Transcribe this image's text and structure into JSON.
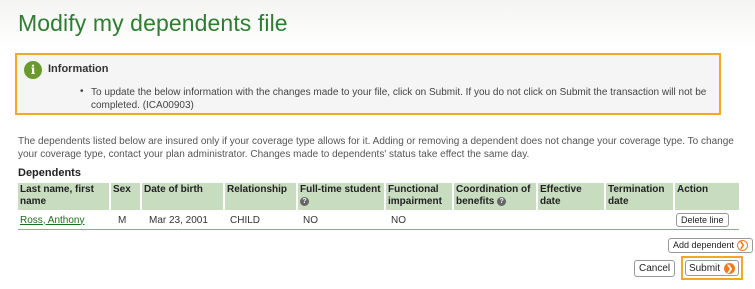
{
  "page": {
    "title": "Modify my dependents file"
  },
  "info": {
    "heading": "Information",
    "icon": "info-icon",
    "bullet": "•",
    "text": "To update the below information with the changes made to your file, click on Submit. If you do not click on Submit the transaction will not be completed. (ICA00903)"
  },
  "intro": "The dependents listed below are insured only if your coverage type allows for it. Adding or removing a dependent does not change your coverage type. To change your coverage type, contact your plan administrator. Changes made to dependents' status take effect the same day.",
  "dependents": {
    "title": "Dependents",
    "columns": {
      "name": "Last name, first name",
      "sex": "Sex",
      "dob": "Date of birth",
      "relationship": "Relationship",
      "fulltime": "Full-time student",
      "functional": "Functional impairment",
      "coordination": "Coordination of benefits",
      "effective": "Effective date",
      "termination": "Termination date",
      "action": "Action"
    },
    "help_glyph": "?",
    "rows": [
      {
        "name": "Ross, Anthony",
        "sex": "M",
        "dob": "Mar 23, 2001",
        "relationship": "CHILD",
        "fulltime": "NO",
        "functional": "NO",
        "coordination": "",
        "effective": "",
        "termination": "",
        "action": "Delete line"
      }
    ]
  },
  "buttons": {
    "add_dependent": "Add dependent",
    "cancel": "Cancel",
    "submit": "Submit",
    "arrow_glyph": "❯"
  },
  "colors": {
    "title": "#2e7d32",
    "highlight": "#f5a623",
    "table_header": "#c8dcc0",
    "accent_arrow": "#f07b1e"
  }
}
